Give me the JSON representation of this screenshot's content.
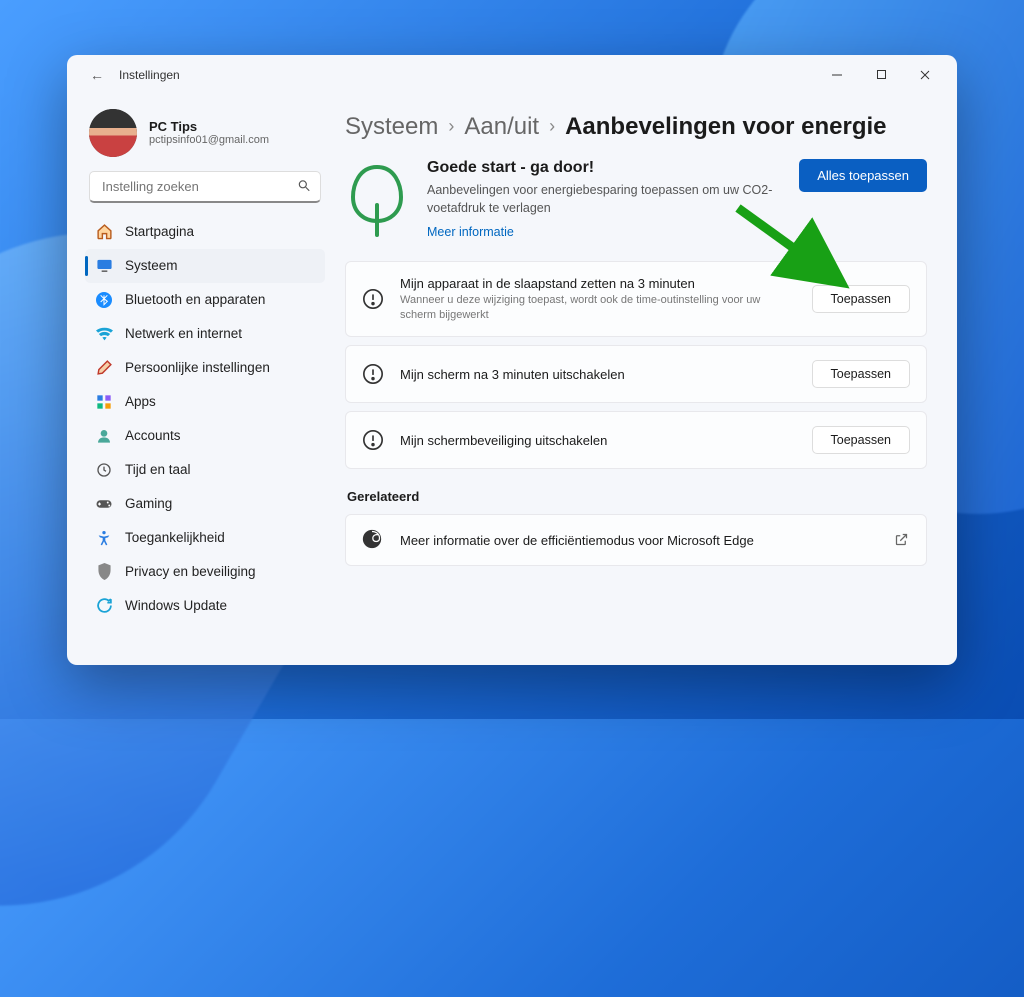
{
  "window": {
    "title": "Instellingen"
  },
  "profile": {
    "name": "PC Tips",
    "email": "pctipsinfo01@gmail.com"
  },
  "search": {
    "placeholder": "Instelling zoeken"
  },
  "sidebar": {
    "items": [
      {
        "label": "Startpagina"
      },
      {
        "label": "Systeem"
      },
      {
        "label": "Bluetooth en apparaten"
      },
      {
        "label": "Netwerk en internet"
      },
      {
        "label": "Persoonlijke instellingen"
      },
      {
        "label": "Apps"
      },
      {
        "label": "Accounts"
      },
      {
        "label": "Tijd en taal"
      },
      {
        "label": "Gaming"
      },
      {
        "label": "Toegankelijkheid"
      },
      {
        "label": "Privacy en beveiliging"
      },
      {
        "label": "Windows Update"
      }
    ]
  },
  "breadcrumbs": {
    "lvl1": "Systeem",
    "lvl2": "Aan/uit",
    "current": "Aanbevelingen voor energie"
  },
  "hero": {
    "title": "Goede start - ga door!",
    "subtitle": "Aanbevelingen voor energiebesparing toepassen om uw CO2-voetafdruk te verlagen",
    "link": "Meer informatie",
    "apply_all": "Alles toepassen"
  },
  "recs": [
    {
      "title": "Mijn apparaat in de slaapstand zetten na 3 minuten",
      "sub": "Wanneer u deze wijziging toepast, wordt ook de time-outinstelling voor uw scherm bijgewerkt",
      "btn": "Toepassen"
    },
    {
      "title": "Mijn scherm na 3 minuten uitschakelen",
      "sub": "",
      "btn": "Toepassen"
    },
    {
      "title": "Mijn schermbeveiliging uitschakelen",
      "sub": "",
      "btn": "Toepassen"
    }
  ],
  "related": {
    "heading": "Gerelateerd",
    "item": "Meer informatie over de efficiëntiemodus voor Microsoft Edge"
  }
}
